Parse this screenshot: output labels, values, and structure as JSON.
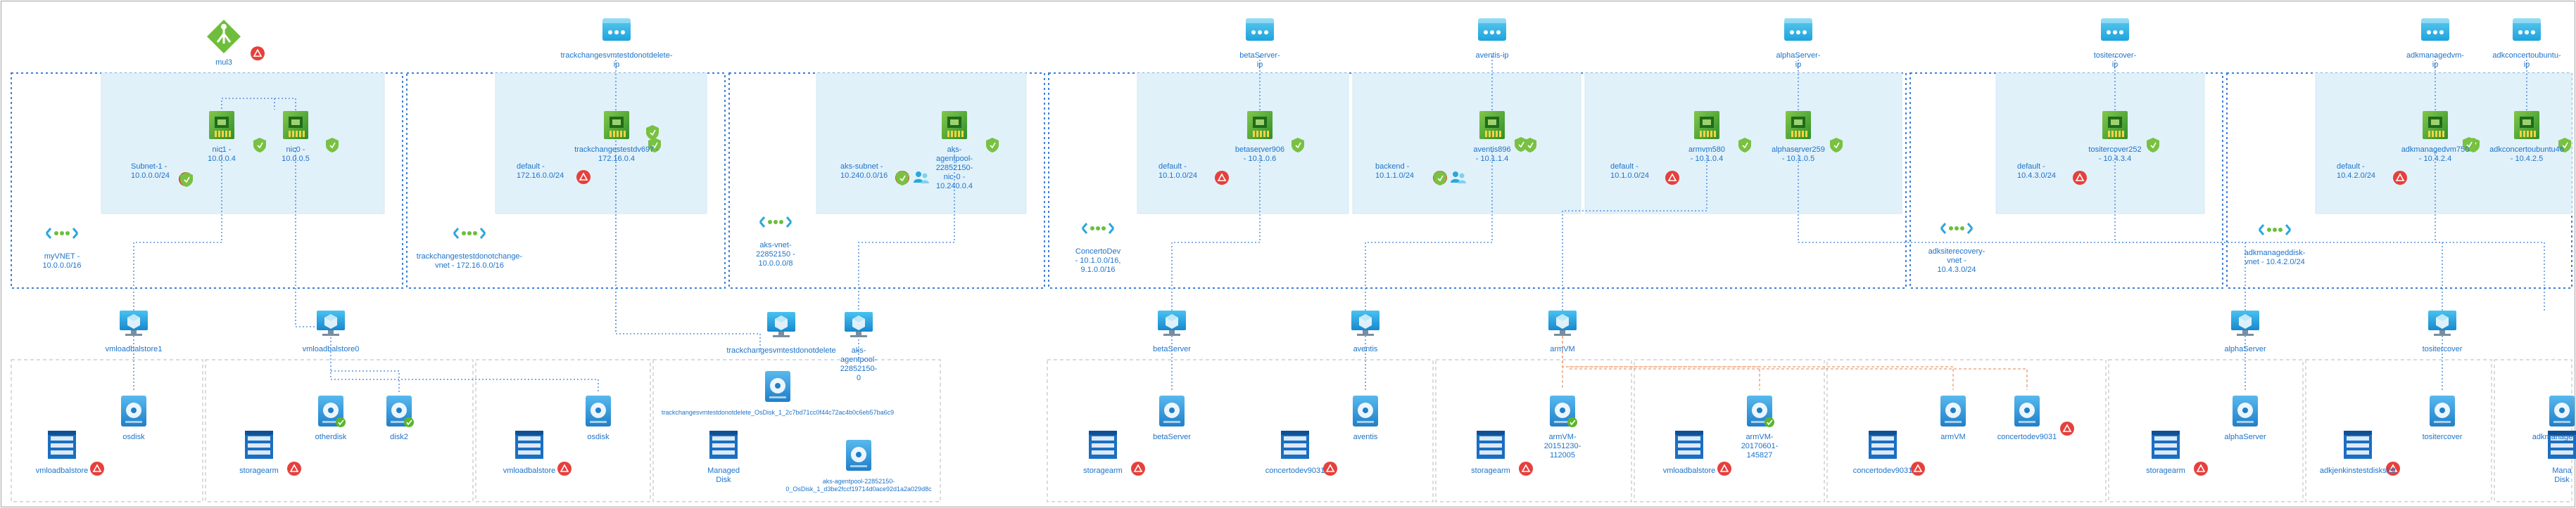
{
  "colors": {
    "link": "#1d73c9",
    "vnet_border": "#3d7fd8",
    "subnet_fill": "#e1f1fa",
    "alert": "#e6403c",
    "ok": "#5db52b",
    "nic": "#2f9e3a",
    "vm": "#2cb2e6",
    "disk": "#2b95d6",
    "storage": "#1a6fc2",
    "pip": "#35b4e2",
    "dash": "#c5c5c5"
  },
  "icons": {
    "pip": "public-ip-icon",
    "nic": "network-interface-icon",
    "vm": "virtual-machine-icon",
    "disk": "managed-disk-icon",
    "storage": "storage-account-icon",
    "vnet": "virtual-network-icon",
    "lb": "load-balancer-icon",
    "alert": "alert-icon",
    "shield": "nsg-shield-icon",
    "users": "users-icon",
    "check": "healthy-check-icon"
  },
  "top": [
    {
      "id": "lb",
      "icon": "lb",
      "label": [
        "mul3"
      ],
      "alert": true
    },
    {
      "id": "pip1",
      "icon": "pip",
      "label": [
        "trackchangesvmtestdonotdelete-",
        "ip"
      ]
    },
    {
      "id": "pip2",
      "icon": "pip",
      "label": [
        "betaServer-",
        "ip"
      ]
    },
    {
      "id": "pip3",
      "icon": "pip",
      "label": [
        "aventis-ip"
      ]
    },
    {
      "id": "pip4",
      "icon": "pip",
      "label": [
        "alphaServer-",
        "ip"
      ]
    },
    {
      "id": "pip5",
      "icon": "pip",
      "label": [
        "tositercover-",
        "ip"
      ]
    },
    {
      "id": "pip6",
      "icon": "pip",
      "label": [
        "adkmanagedvm-",
        "ip"
      ]
    },
    {
      "id": "pip7",
      "icon": "pip",
      "label": [
        "adkconcertoubuntu-",
        "ip"
      ]
    }
  ],
  "vnets": [
    {
      "label": [
        "myVNET -",
        "10.0.0.0/16"
      ]
    },
    {
      "label": [
        "trackchangestestdonotchange-",
        "vnet - 172.16.0.0/16"
      ]
    },
    {
      "label": [
        "aks-vnet-",
        "22852150 -",
        "",
        "10.0.0.0/8"
      ]
    },
    {
      "label": [
        "ConcertoDev",
        "- 10.1.0.0/16,",
        "9.1.0.0/16"
      ]
    },
    {
      "label": [
        "adksiterecovery-",
        "vnet -",
        "10.4.3.0/24"
      ]
    },
    {
      "label": [
        "adkmanageddisk-",
        "vnet - 10.4.2.0/24"
      ]
    }
  ],
  "subnets": [
    {
      "label": [
        "Subnet-1 -",
        "10.0.0.0/24"
      ]
    },
    {
      "label": [
        "default -",
        "172.16.0.0/24"
      ]
    },
    {
      "label": [
        "aks-subnet -",
        "10.240.0.0/16"
      ]
    },
    {
      "label": [
        "default -",
        "10.1.0.0/24"
      ]
    },
    {
      "label": [
        "backend -",
        "10.1.1.0/24"
      ]
    },
    {
      "label": [
        "default -",
        "10.1.0.0/24"
      ]
    },
    {
      "label": [
        "default -",
        "10.4.3.0/24"
      ]
    },
    {
      "label": [
        "default -",
        "10.4.2.0/24"
      ]
    }
  ],
  "nics": [
    {
      "label": [
        "nic1 -",
        "10.0.0.4"
      ]
    },
    {
      "label": [
        "nic0 -",
        "10.0.0.5"
      ]
    },
    {
      "label": [
        "trackchangestestdv697 -",
        "172.16.0.4"
      ]
    },
    {
      "label": [
        "aks-",
        "agentpool-",
        "22852150-",
        "nic-0 -",
        "10.240.0.4"
      ]
    },
    {
      "label": [
        "betaserver906",
        "- 10.1.0.6"
      ]
    },
    {
      "label": [
        "aventis896",
        "- 10.1.1.4"
      ]
    },
    {
      "label": [
        "armvm580",
        "- 10.1.0.4"
      ]
    },
    {
      "label": [
        "alphaserver259",
        "- 10.1.0.5"
      ]
    },
    {
      "label": [
        "tositercover252",
        "- 10.4.3.4"
      ]
    },
    {
      "label": [
        "adkmanagedvm750",
        "- 10.4.2.4"
      ]
    },
    {
      "label": [
        "adkconcertoubuntu46",
        "- 10.4.2.5"
      ]
    }
  ],
  "vms": [
    {
      "label": [
        "vmloadbalstore1"
      ]
    },
    {
      "label": [
        "vmloadbalstore0"
      ]
    },
    {
      "label": [
        "trackchangesvmtestdonotdelete"
      ]
    },
    {
      "label": [
        "aks-",
        "agentpool-",
        "22852150-",
        "0"
      ]
    },
    {
      "label": [
        "betaServer"
      ]
    },
    {
      "label": [
        "aventis"
      ]
    },
    {
      "label": [
        "armVM"
      ]
    },
    {
      "label": [
        "alphaServer"
      ]
    },
    {
      "label": [
        "tositercover"
      ]
    }
  ],
  "disks": [
    {
      "label": [
        "osdisk"
      ]
    },
    {
      "label": [
        "otherdisk"
      ]
    },
    {
      "label": [
        "disk2"
      ]
    },
    {
      "label": [
        "osdisk"
      ]
    },
    {
      "label": [
        "trackchangesvmtestdonotdelete_OsDisk_1_2c7bd71cc0f44c72ac4b0c6eb57ba6c9"
      ]
    },
    {
      "label": [
        "aks-agentpool-22852150-",
        "0_OsDisk_1_d3be2fccf19714d0ace92d1a2a029d8c"
      ]
    },
    {
      "label": [
        "betaServer"
      ]
    },
    {
      "label": [
        "aventis"
      ]
    },
    {
      "label": [
        "armVM-",
        "20151230-",
        "112005"
      ]
    },
    {
      "label": [
        "armVM-",
        "20170601-",
        "145827"
      ]
    },
    {
      "label": [
        "armVM"
      ]
    },
    {
      "label": [
        "concertodev9031"
      ]
    },
    {
      "label": [
        "alphaServer"
      ]
    },
    {
      "label": [
        "tositercover"
      ]
    },
    {
      "label": [
        "adkmanagedvm_"
      ]
    }
  ],
  "storage": [
    {
      "label": [
        "vmloadbalstore"
      ]
    },
    {
      "label": [
        "storagearm"
      ]
    },
    {
      "label": [
        "vmloadbalstore"
      ]
    },
    {
      "label": [
        "Managed",
        "Disk"
      ]
    },
    {
      "label": [
        "storagearm"
      ]
    },
    {
      "label": [
        "concertodev9031"
      ]
    },
    {
      "label": [
        "storagearm"
      ]
    },
    {
      "label": [
        "vmloadbalstore"
      ]
    },
    {
      "label": [
        "concertodev9031"
      ]
    },
    {
      "label": [
        "storagearm"
      ]
    },
    {
      "label": [
        "adkjenkinstestdiskslist"
      ]
    },
    {
      "label": [
        "Mana",
        "Disk"
      ]
    }
  ]
}
